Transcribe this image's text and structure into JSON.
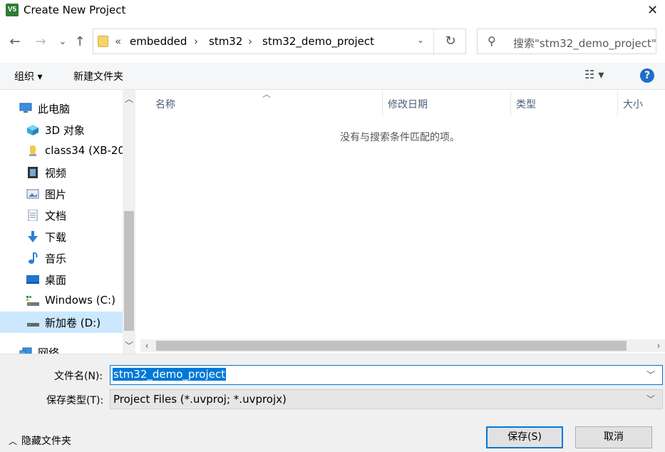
{
  "window": {
    "title": "Create New Project",
    "app_icon_text": "V5"
  },
  "nav": {
    "back": "←",
    "forward": "→",
    "recent": "⌄",
    "up": "↑"
  },
  "address": {
    "overflow": "«",
    "crumbs": [
      "embedded",
      "stm32",
      "stm32_demo_project"
    ],
    "separator": "›",
    "dropdown": "⌄",
    "refresh": "↻"
  },
  "search": {
    "placeholder": "搜索\"stm32_demo_project\""
  },
  "toolbar": {
    "organize_label": "组织 ▾",
    "new_folder_label": "新建文件夹",
    "view_label": "☷ ▾",
    "help_label": "?"
  },
  "sidebar": {
    "items": [
      {
        "label": "此电脑",
        "icon": "computer-icon"
      },
      {
        "label": "3D 对象",
        "icon": "cube-icon"
      },
      {
        "label": "class34 (XB-20",
        "icon": "user-folder-icon"
      },
      {
        "label": "视频",
        "icon": "video-icon"
      },
      {
        "label": "图片",
        "icon": "picture-icon"
      },
      {
        "label": "文档",
        "icon": "document-icon"
      },
      {
        "label": "下载",
        "icon": "download-icon"
      },
      {
        "label": "音乐",
        "icon": "music-icon"
      },
      {
        "label": "桌面",
        "icon": "desktop-icon"
      },
      {
        "label": "Windows (C:)",
        "icon": "drive-icon"
      },
      {
        "label": "新加卷 (D:)",
        "icon": "drive-icon"
      },
      {
        "label": "网络",
        "icon": "network-icon"
      }
    ]
  },
  "columns": {
    "name": "名称",
    "modified": "修改日期",
    "type": "类型",
    "size": "大小"
  },
  "file_list": {
    "empty_message": "没有与搜索条件匹配的项。"
  },
  "form": {
    "filename_label": "文件名(N):",
    "filename_value": "stm32_demo_project",
    "filetype_label": "保存类型(T):",
    "filetype_value": "Project Files (*.uvproj; *.uvprojx)"
  },
  "footer": {
    "hide_folders": "隐藏文件夹",
    "save": "保存(S)",
    "cancel": "取消"
  },
  "colors": {
    "accent": "#0078d7",
    "selection": "#cce8ff"
  }
}
